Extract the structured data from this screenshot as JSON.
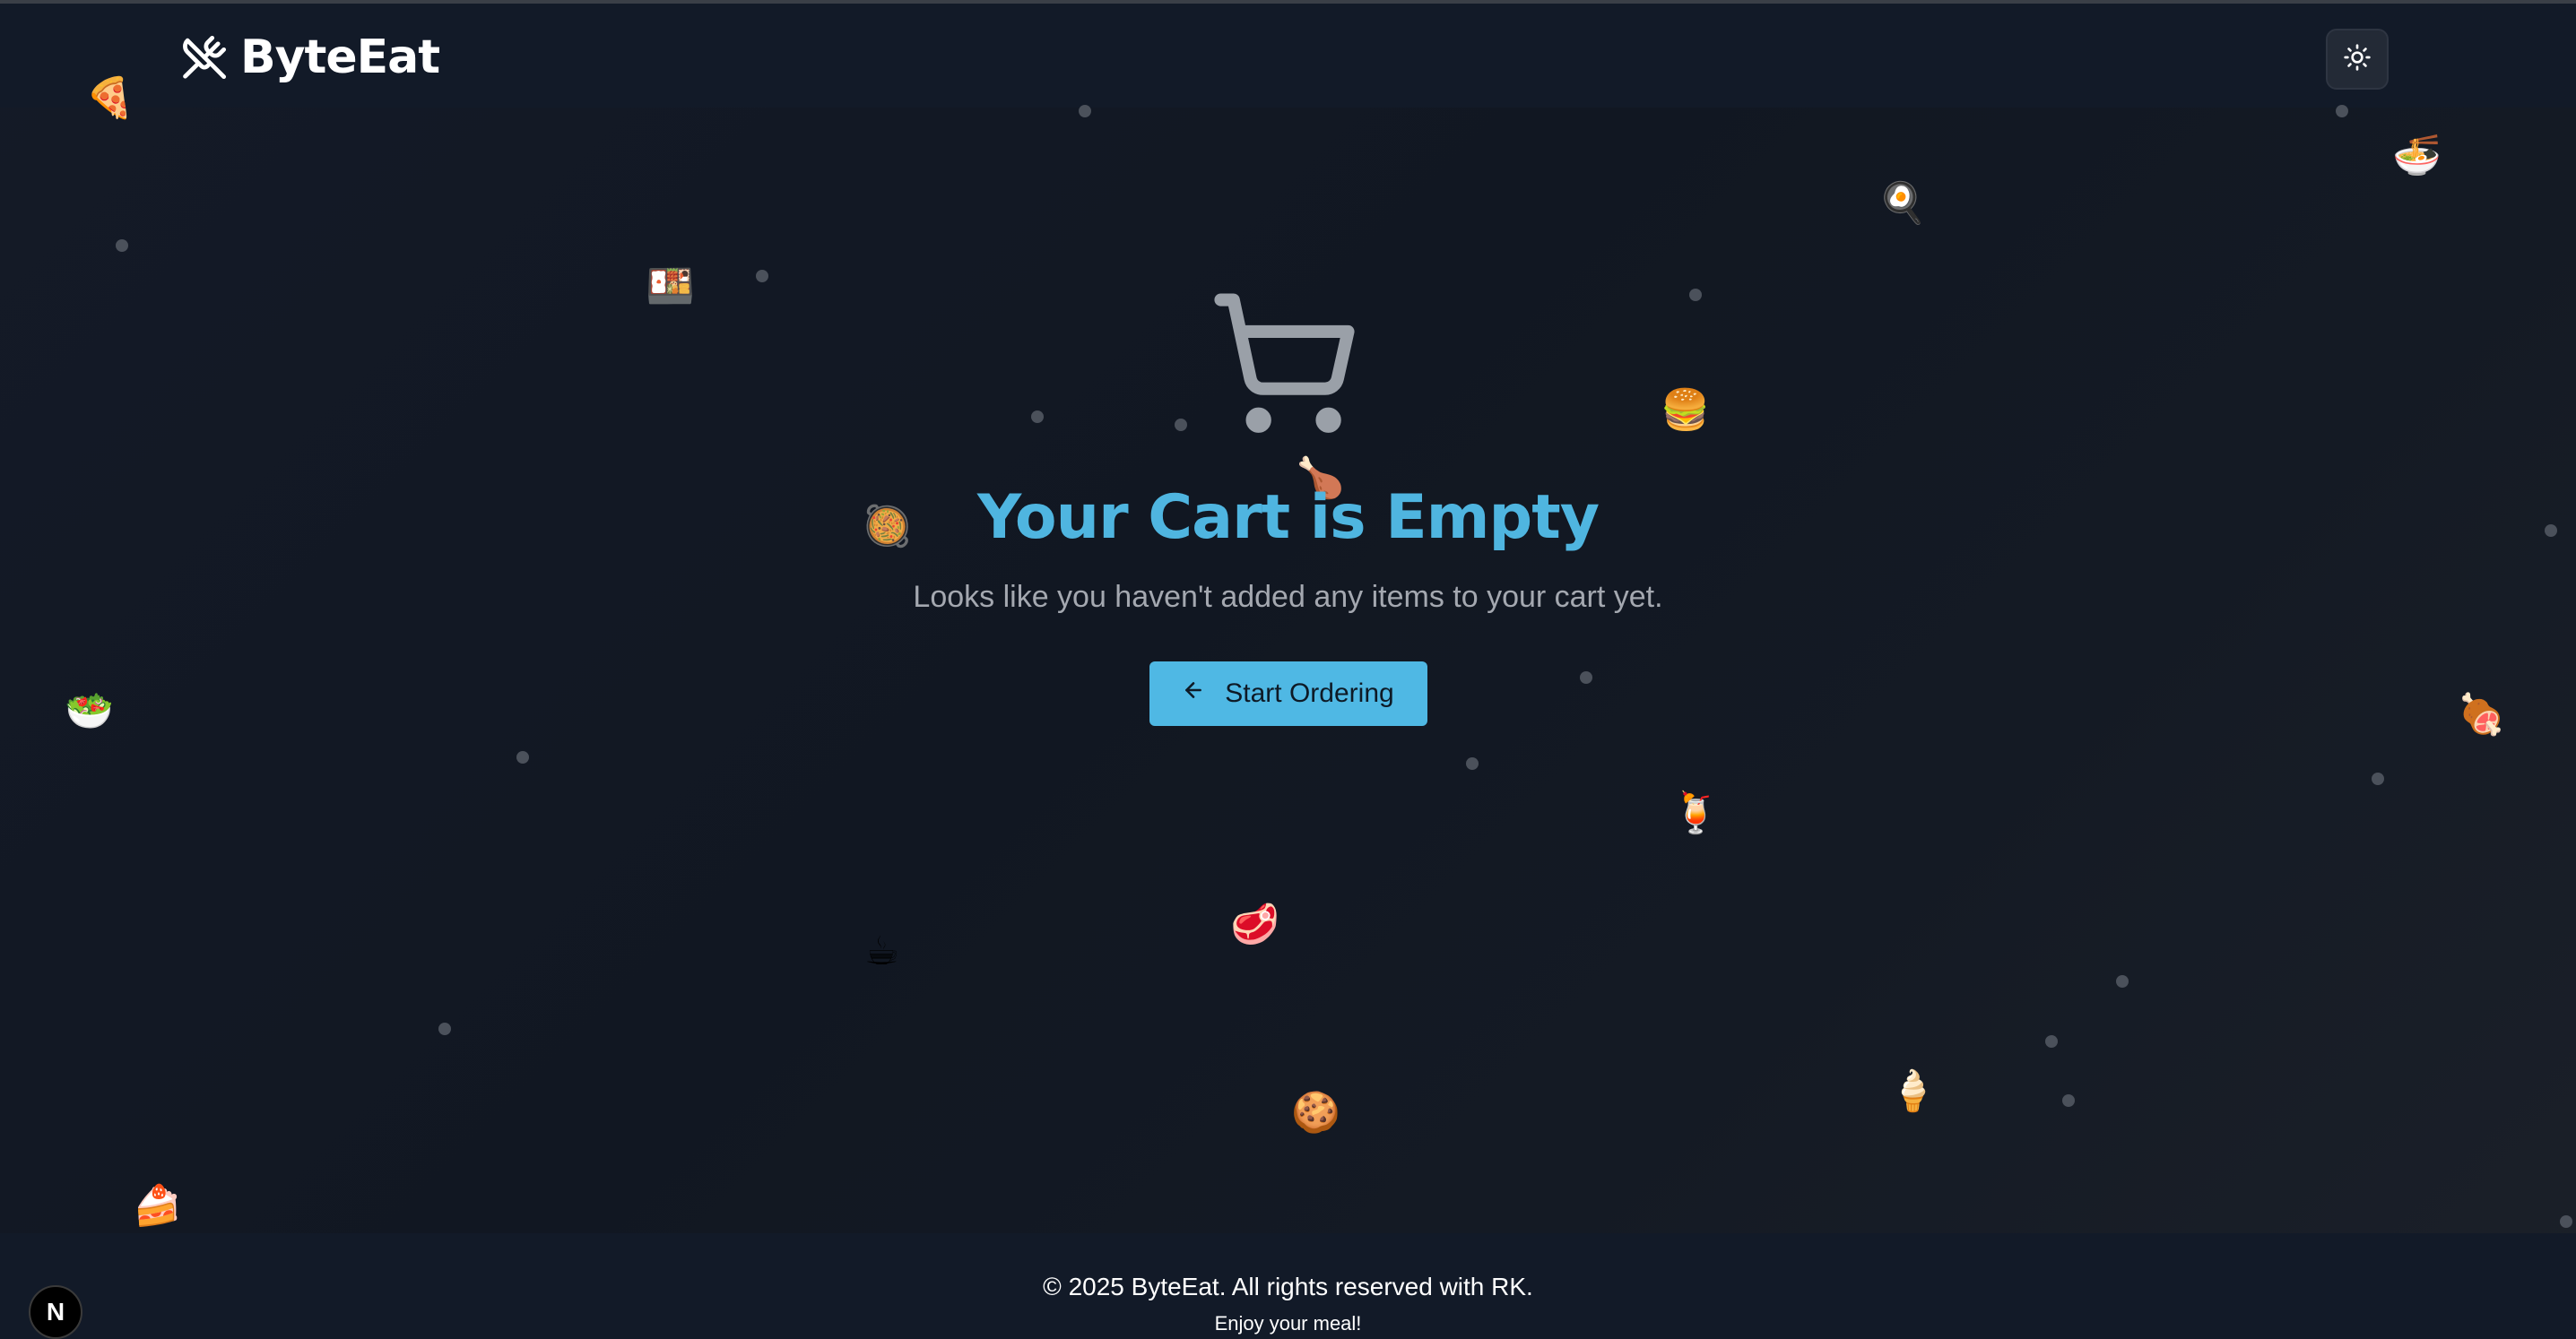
{
  "header": {
    "brand_name": "ByteEat",
    "brand_icon": "utensils-crossed-icon",
    "theme_toggle_icon": "sun-icon"
  },
  "main": {
    "empty_icon": "shopping-cart-icon",
    "title": "Your Cart is Empty",
    "subtitle": "Looks like you haven't added any items to your cart yet.",
    "cta_icon": "arrow-left-icon",
    "cta_label": "Start Ordering"
  },
  "decorations": {
    "food_emojis": [
      "🍕",
      "🍱",
      "🍳",
      "🍜",
      "🍔",
      "🍗",
      "🥘",
      "🥗",
      "🍹",
      "🍖",
      "☕",
      "🥩",
      "🍪",
      "🍦",
      "🍰"
    ]
  },
  "footer": {
    "copyright": "© 2025 ByteEat. All rights reserved with RK.",
    "tagline": "Enjoy your meal!"
  },
  "dev_badge": {
    "label": "N"
  },
  "colors": {
    "accent": "#4fb8e4",
    "title": "#4fb5e0",
    "background": "#141a26",
    "header_bg": "#121a28",
    "muted_text": "#a4a8b0"
  }
}
